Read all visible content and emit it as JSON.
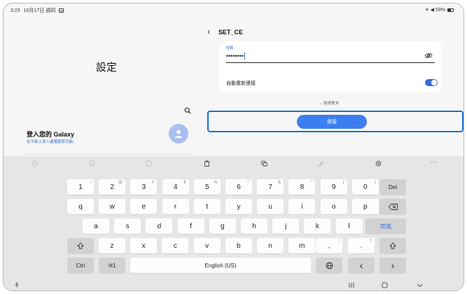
{
  "status_bar": {
    "time": "3:23",
    "date": "10月17日 週四",
    "indicators": "✈ ◀ 59%"
  },
  "left_pane": {
    "title": "設定",
    "account_title": "登入您的 Galaxy",
    "account_subtitle": "在平板上加入進階智慧功能。"
  },
  "right_pane": {
    "network_name": "SET_CE",
    "password_label": "密碼",
    "password_value": "••••••••",
    "auto_reconnect_label": "自動重新連接",
    "auto_reconnect_on": true,
    "view_more": "檢視更多",
    "connect_label": "連接"
  },
  "keyboard": {
    "row1": [
      {
        "label": "1",
        "hint": "!"
      },
      {
        "label": "2",
        "hint": "@"
      },
      {
        "label": "3",
        "hint": "#"
      },
      {
        "label": "4",
        "hint": "$"
      },
      {
        "label": "5",
        "hint": "%"
      },
      {
        "label": "6",
        "hint": "^"
      },
      {
        "label": "7",
        "hint": "&"
      },
      {
        "label": "8",
        "hint": "*"
      },
      {
        "label": "9",
        "hint": "("
      },
      {
        "label": "0",
        "hint": ")"
      }
    ],
    "row2": [
      "q",
      "w",
      "e",
      "r",
      "t",
      "y",
      "u",
      "i",
      "o",
      "p"
    ],
    "row3": [
      "a",
      "s",
      "d",
      "f",
      "g",
      "h",
      "j",
      "k",
      "l"
    ],
    "row4": [
      "z",
      "x",
      "c",
      "v",
      "b",
      "n",
      "m"
    ],
    "del_label": "Del",
    "done_label": "完成",
    "ctrl_label": "Ctrl",
    "symbols_label": "!#1",
    "space_label": "English (US)",
    "comma_key": ",",
    "comma_hint": "!",
    "period_key": ".",
    "period_hint": "?",
    "left_arrow": "‹",
    "right_arrow": "›"
  },
  "colors": {
    "accent": "#3d7ef2",
    "highlight_border": "#1b6fcf",
    "keyboard_bg": "#e6e6e6"
  }
}
